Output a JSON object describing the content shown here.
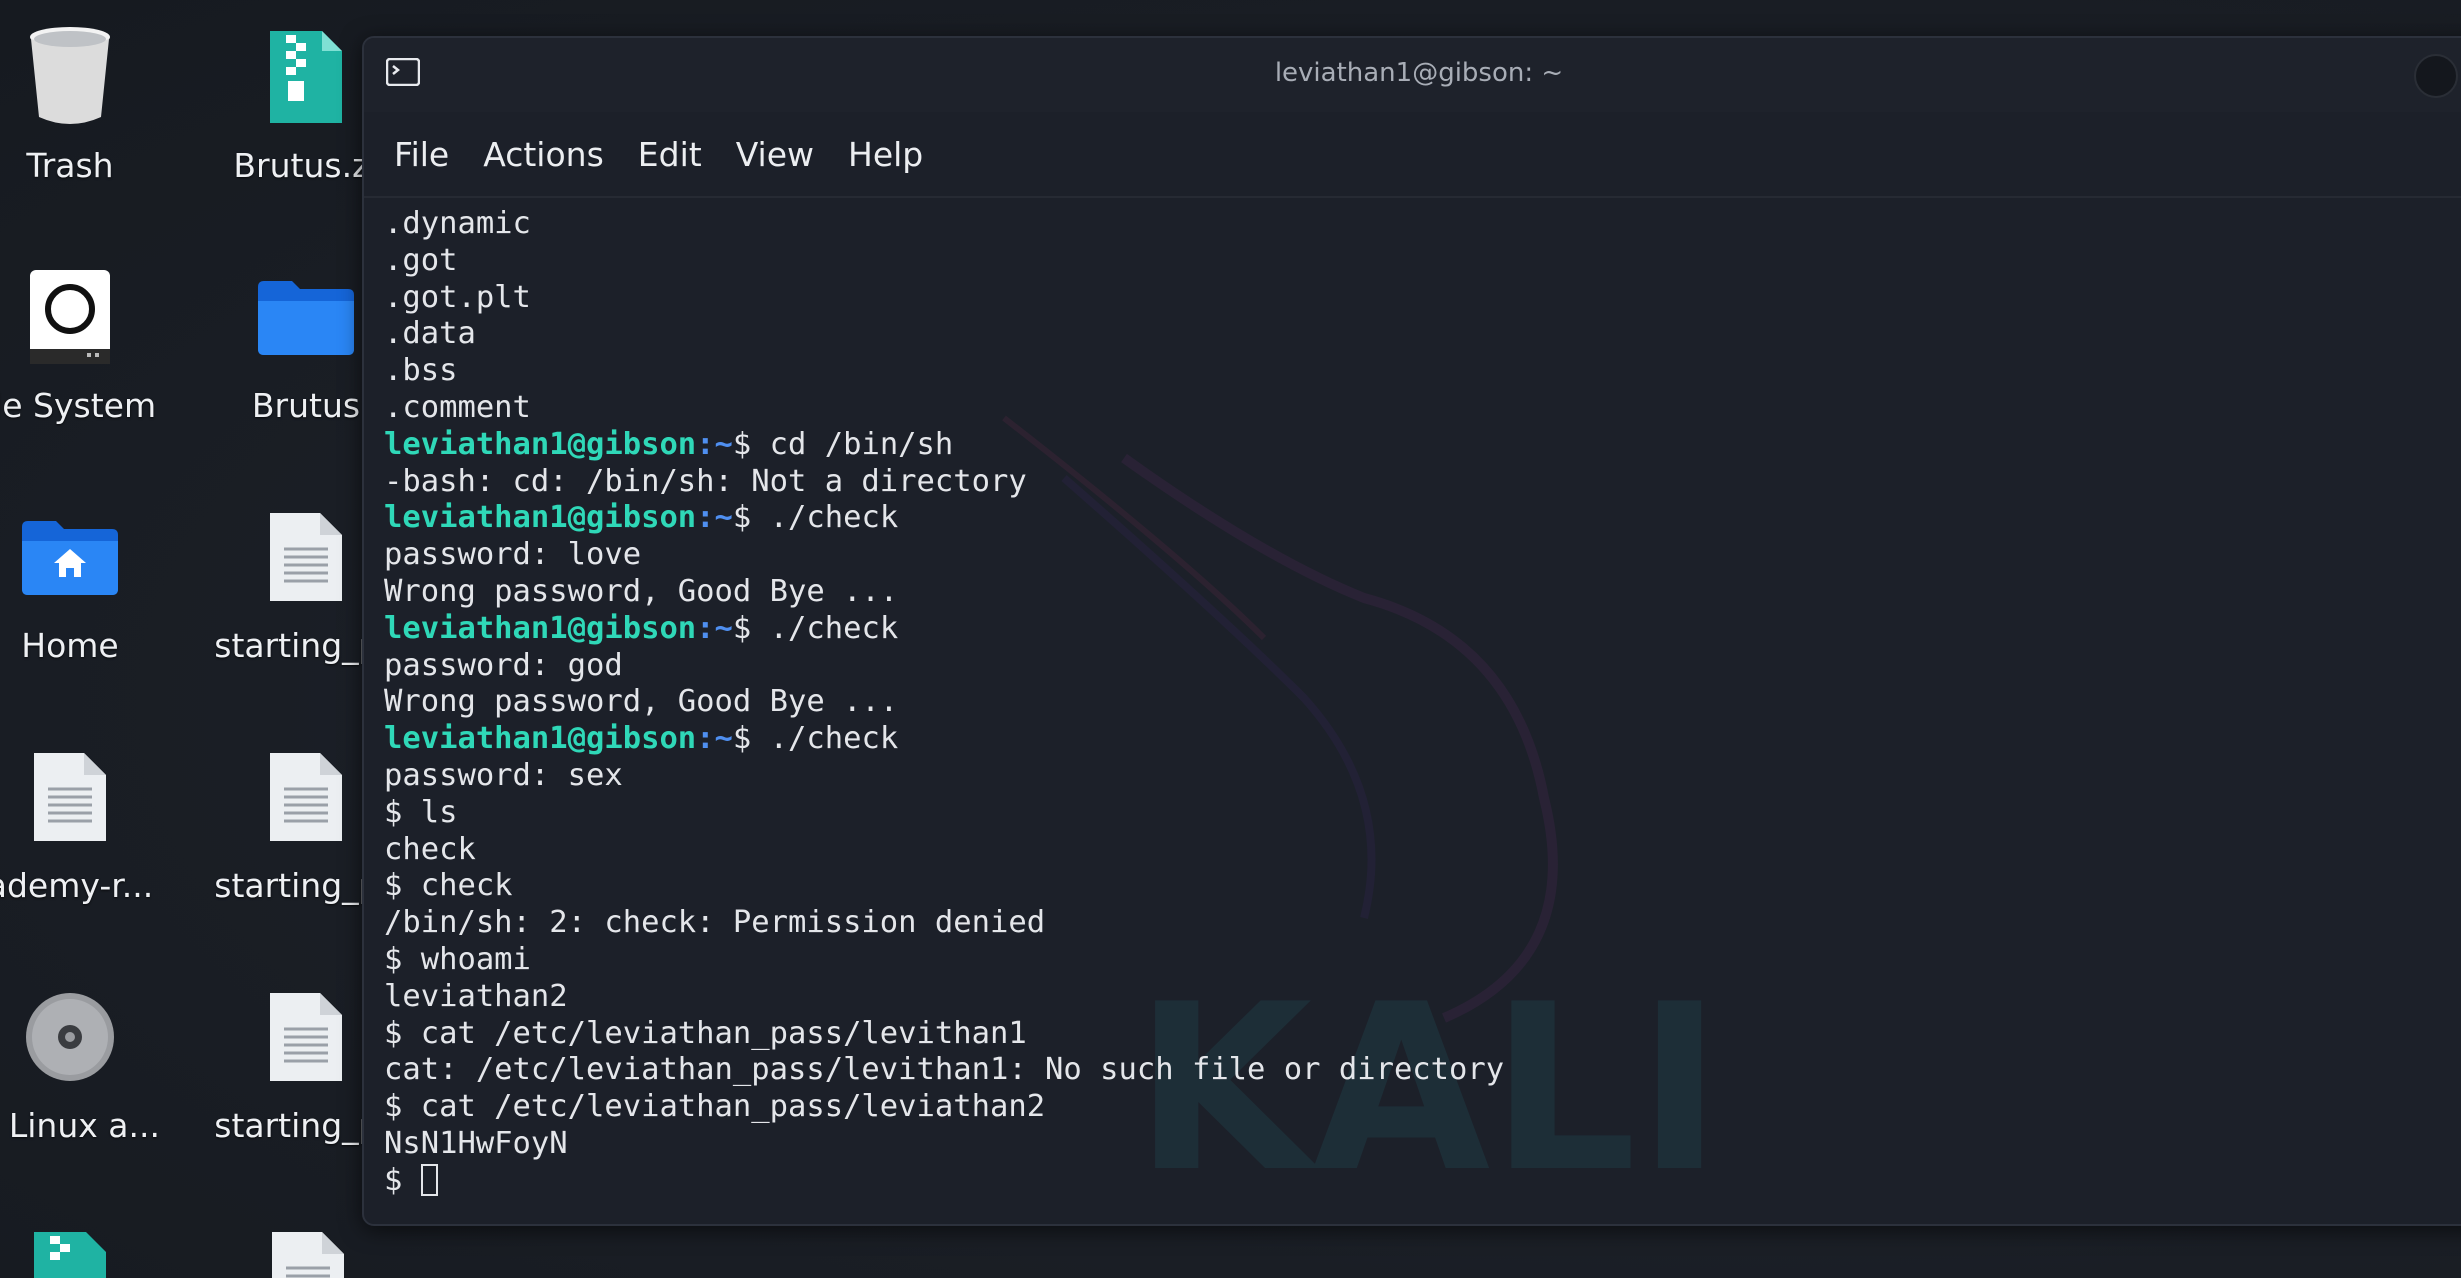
{
  "desktop": {
    "icons": [
      {
        "label": "Trash",
        "icon": "trash-icon"
      },
      {
        "label": "Brutus.zi",
        "icon": "zip-archive-icon"
      },
      {
        "label": "ile System",
        "icon": "drive-icon"
      },
      {
        "label": "Brutus",
        "icon": "folder-icon"
      },
      {
        "label": "Home",
        "icon": "home-folder-icon"
      },
      {
        "label": "starting_pc",
        "icon": "text-file-icon"
      },
      {
        "label": "ademy-r...",
        "icon": "text-file-icon"
      },
      {
        "label": "starting_pc",
        "icon": "text-file-icon"
      },
      {
        "label": "li Linux a...",
        "icon": "disc-icon"
      },
      {
        "label": "starting_pc",
        "icon": "text-file-icon"
      }
    ]
  },
  "terminal": {
    "title": "leviathan1@gibson: ~",
    "menu": [
      "File",
      "Actions",
      "Edit",
      "View",
      "Help"
    ],
    "prompt_user": "leviathan1@gibson",
    "prompt_path": ":~",
    "prompt_symbol": "$",
    "lines": [
      {
        "text": ".dynamic"
      },
      {
        "text": ".got"
      },
      {
        "text": ".got.plt"
      },
      {
        "text": ".data"
      },
      {
        "text": ".bss"
      },
      {
        "text": ".comment"
      },
      {
        "prompt": true,
        "cmd": " cd /bin/sh"
      },
      {
        "text": "-bash: cd: /bin/sh: Not a directory"
      },
      {
        "prompt": true,
        "cmd": " ./check"
      },
      {
        "text": "password: love"
      },
      {
        "text": "Wrong password, Good Bye ..."
      },
      {
        "prompt": true,
        "cmd": " ./check"
      },
      {
        "text": "password: god"
      },
      {
        "text": "Wrong password, Good Bye ..."
      },
      {
        "prompt": true,
        "cmd": " ./check"
      },
      {
        "text": "password: sex"
      },
      {
        "text": "$ ls"
      },
      {
        "text": "check"
      },
      {
        "text": "$ check"
      },
      {
        "text": "/bin/sh: 2: check: Permission denied"
      },
      {
        "text": "$ whoami"
      },
      {
        "text": "leviathan2"
      },
      {
        "text": "$ cat /etc/leviathan_pass/levithan1"
      },
      {
        "text": "cat: /etc/leviathan_pass/levithan1: No such file or directory"
      },
      {
        "text": "$ cat /etc/leviathan_pass/leviathan2"
      },
      {
        "text": "NsN1HwFoyN"
      },
      {
        "text": "$ ",
        "cursor": true
      }
    ],
    "watermark_text": "KALI",
    "colors": {
      "prompt_user": "#2fd8b8",
      "prompt_path": "#4f8ff0",
      "background": "#1c2029"
    }
  }
}
